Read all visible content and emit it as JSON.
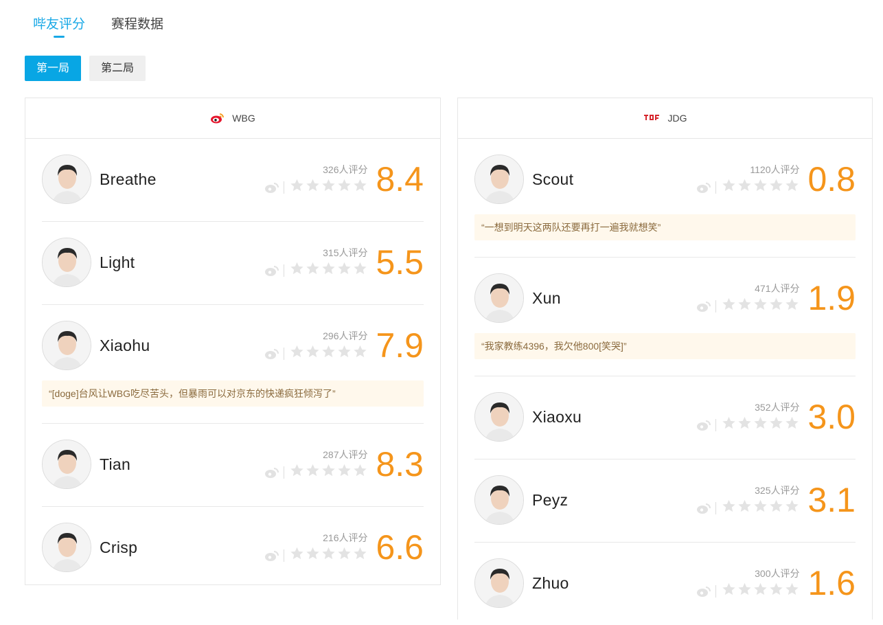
{
  "tabs": [
    {
      "label": "哔友评分",
      "active": true
    },
    {
      "label": "赛程数据",
      "active": false
    }
  ],
  "rounds": [
    {
      "label": "第一局",
      "active": true
    },
    {
      "label": "第二局",
      "active": false
    }
  ],
  "colors": {
    "accent": "#18a8e6",
    "score": "#f5951b",
    "comment_bg": "#fff8ec",
    "star": "#e3e3e3"
  },
  "teams": [
    {
      "name": "WBG",
      "logo": "weibo-logo-icon",
      "players": [
        {
          "name": "Breathe",
          "count": "326人评分",
          "score": "8.4",
          "comment": ""
        },
        {
          "name": "Light",
          "count": "315人评分",
          "score": "5.5",
          "comment": ""
        },
        {
          "name": "Xiaohu",
          "count": "296人评分",
          "score": "7.9",
          "comment": "“[doge]台风让WBG吃尽苦头，但暴雨可以对京东的快递疯狂倾泻了”"
        },
        {
          "name": "Tian",
          "count": "287人评分",
          "score": "8.3",
          "comment": ""
        },
        {
          "name": "Crisp",
          "count": "216人评分",
          "score": "6.6",
          "comment": ""
        }
      ]
    },
    {
      "name": "JDG",
      "logo": "jdg-logo-icon",
      "players": [
        {
          "name": "Scout",
          "count": "1120人评分",
          "score": "0.8",
          "comment": "“一想到明天这两队还要再打一遍我就想笑”"
        },
        {
          "name": "Xun",
          "count": "471人评分",
          "score": "1.9",
          "comment": "“我家教练4396，我欠他800[笑哭]”"
        },
        {
          "name": "Xiaoxu",
          "count": "352人评分",
          "score": "3.0",
          "comment": ""
        },
        {
          "name": "Peyz",
          "count": "325人评分",
          "score": "3.1",
          "comment": ""
        },
        {
          "name": "Zhuo",
          "count": "300人评分",
          "score": "1.6",
          "comment": ""
        }
      ]
    }
  ]
}
